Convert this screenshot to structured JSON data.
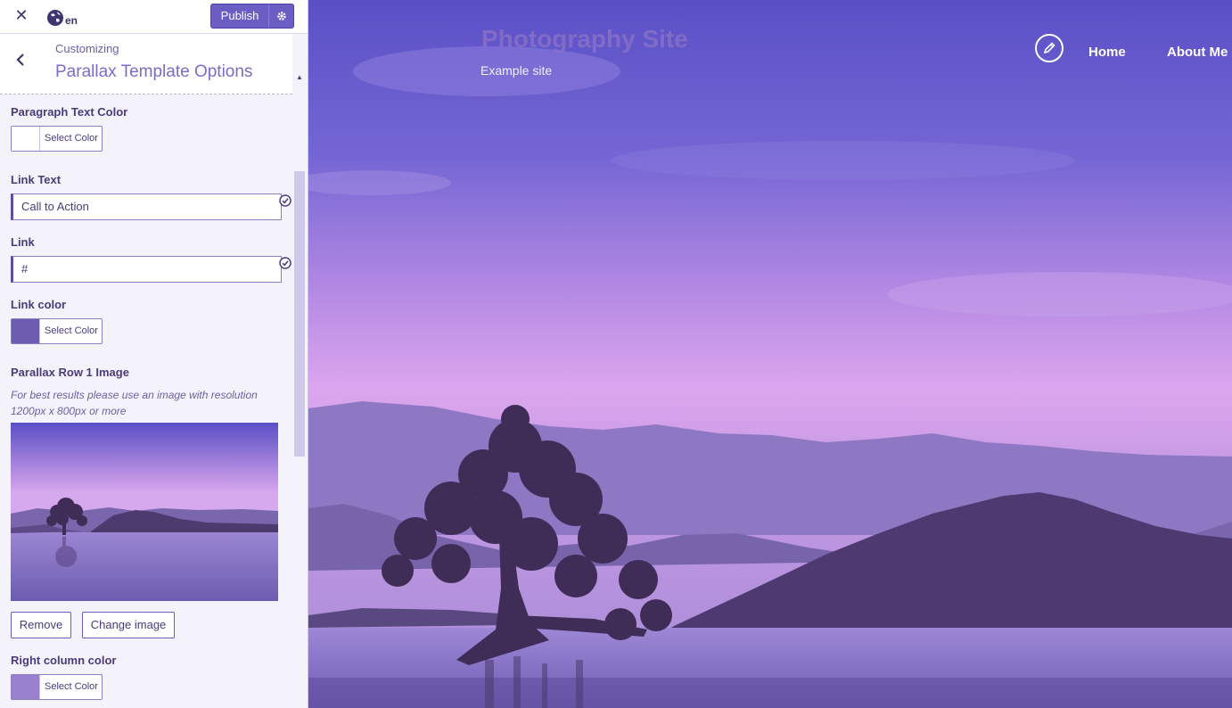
{
  "topbar": {
    "close_icon": "close-icon",
    "language_code": "en",
    "publish_label": "Publish"
  },
  "panel": {
    "breadcrumb": "Customizing",
    "title": "Parallax Template Options"
  },
  "fields": {
    "paragraph_text_color": {
      "label": "Paragraph Text Color",
      "button": "Select Color",
      "swatch": "#ffffff"
    },
    "link_text": {
      "label": "Link Text",
      "value": "Call to Action"
    },
    "link": {
      "label": "Link",
      "value": "#"
    },
    "link_color": {
      "label": "Link color",
      "button": "Select Color",
      "swatch": "#6e5cb0"
    },
    "parallax_row1_image": {
      "label": "Parallax Row 1 Image",
      "hint": "For best results please use an image with resolution 1200px x 800px or more",
      "remove_label": "Remove",
      "change_label": "Change image"
    },
    "right_column_color": {
      "label": "Right column color",
      "button": "Select Color",
      "swatch": "#9880cf"
    }
  },
  "preview": {
    "site_title": "Photography Site",
    "tagline": "Example site",
    "nav": [
      "Home",
      "About Me"
    ]
  },
  "colors": {
    "accent": "#6a5dc4",
    "sky_top": "#5a50c6",
    "sky_glow": "#dca6ee",
    "silhouette": "#402e58"
  }
}
